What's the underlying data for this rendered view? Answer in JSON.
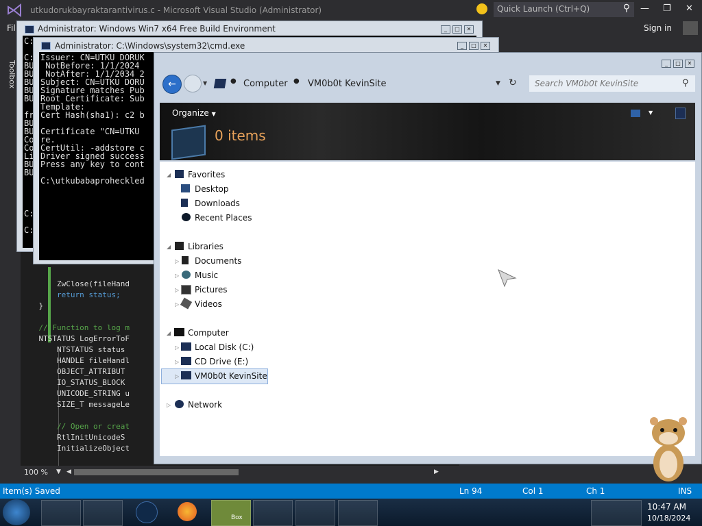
{
  "visual_studio": {
    "title": "utkudorukbayraktarantivirus.c - Microsoft Visual Studio (Administrator)",
    "quick_launch_placeholder": "Quick Launch (Ctrl+Q)",
    "menu_file": "Fil",
    "sign_in": "Sign in",
    "toolbox": "Toolbox",
    "zoom": "100 %",
    "code_lines": [
      "        ZwClose(fileHand",
      "        return status;",
      "    }",
      "",
      "    // Function to log m",
      "    NTSTATUS LogErrorToF",
      "        NTSTATUS status",
      "        HANDLE fileHandl",
      "        OBJECT_ATTRIBUT",
      "        IO_STATUS_BLOCK",
      "        UNICODE_STRING u",
      "        SIZE_T messageLe",
      "",
      "        // Open or creat",
      "        RtlInitUnicodeS",
      "        InitializeObject"
    ],
    "status": {
      "left": "Item(s) Saved",
      "ln": "Ln 94",
      "col": "Col 1",
      "ch": "Ch 1",
      "mode": "INS"
    }
  },
  "wbe_window": {
    "title": "Administrator:  Windows Win7 x64 Free Build Environment",
    "lines": [
      "C:",
      "",
      "C:",
      "BU",
      "BU",
      "BU",
      "BU",
      "BU",
      "",
      "fr",
      "BU",
      "BU",
      "Co",
      "Co",
      "Li",
      "BU",
      "BU",
      "",
      "",
      "",
      "",
      "C:",
      "",
      "C:"
    ]
  },
  "cmd_window": {
    "title": "Administrator: C:\\Windows\\system32\\cmd.exe",
    "lines": [
      "Issuer: CN=UTKU DORUK",
      " NotBefore: 1/1/2024",
      " NotAfter: 1/1/2034 2",
      "Subject: CN=UTKU DORU",
      "Signature matches Pub",
      "Root Certificate: Sub",
      "Template:",
      "Cert Hash(sha1): c2 b",
      "",
      "Certificate \"CN=UTKU",
      "re.",
      "CertUtil: -addstore c",
      "Driver signed success",
      "Press any key to cont",
      "",
      "C:\\utkubabaproheckled"
    ]
  },
  "explorer": {
    "breadcrumb": [
      "Computer",
      "VM0b0t KevinSite"
    ],
    "search_placeholder": "Search VM0b0t KevinSite",
    "organize": "Organize",
    "items_count": "0 items",
    "tree": {
      "favorites": {
        "label": "Favorites",
        "items": [
          "Desktop",
          "Downloads",
          "Recent Places"
        ]
      },
      "libraries": {
        "label": "Libraries",
        "items": [
          "Documents",
          "Music",
          "Pictures",
          "Videos"
        ]
      },
      "computer": {
        "label": "Computer",
        "items": [
          "Local Disk (C:)",
          "CD Drive (E:)",
          "VM0b0t KevinSite"
        ]
      },
      "network": {
        "label": "Network"
      }
    }
  },
  "taskbar": {
    "time": "10:47 AM",
    "date": "10/18/2024",
    "apps": [
      "explorer-icon",
      "media-player-icon",
      "orb-icon",
      "firefox-icon",
      "box-game-icon",
      "visual-studio-icon",
      "console-icon",
      "console-icon-2"
    ],
    "box_label": "Box"
  },
  "colors": {
    "vs_status": "#007acc",
    "vs_bg": "#2d2d30",
    "orange_count": "#e8a25a"
  }
}
